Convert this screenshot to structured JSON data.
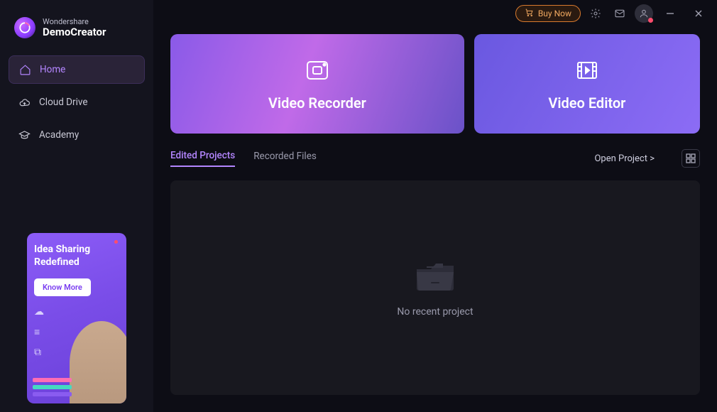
{
  "logo": {
    "brand": "Wondershare",
    "product": "DemoCreator"
  },
  "nav": {
    "home": "Home",
    "cloud": "Cloud Drive",
    "academy": "Academy"
  },
  "promo": {
    "title_line1": "Idea Sharing",
    "title_line2": "Redefined",
    "button": "Know More"
  },
  "titlebar": {
    "buy": "Buy Now"
  },
  "cards": {
    "recorder": "Video Recorder",
    "editor": "Video Editor"
  },
  "tabs": {
    "edited": "Edited Projects",
    "recorded": "Recorded Files"
  },
  "actions": {
    "open_project": "Open Project  >"
  },
  "empty": {
    "message": "No recent project"
  }
}
